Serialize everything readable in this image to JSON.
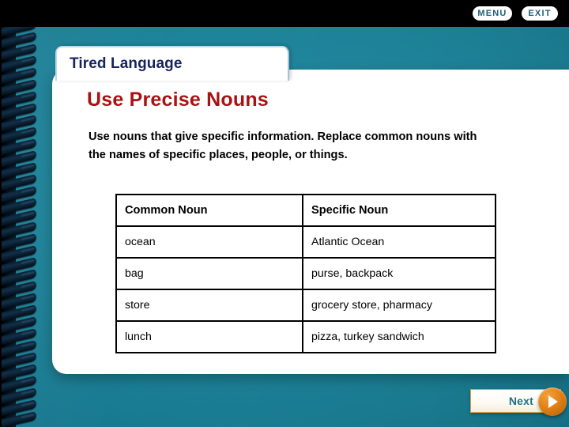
{
  "topbar": {
    "menu_label": "MENU",
    "exit_label": "EXIT"
  },
  "slide": {
    "tab_title": "Tired Language",
    "heading": "Use Precise Nouns",
    "body": "Use nouns that give specific information. Replace common nouns with the names of specific places, people, or things."
  },
  "table": {
    "headers": [
      "Common Noun",
      "Specific Noun"
    ],
    "rows": [
      [
        "ocean",
        "Atlantic Ocean"
      ],
      [
        "bag",
        "purse, backpack"
      ],
      [
        "store",
        "grocery store, pharmacy"
      ],
      [
        "lunch",
        "pizza, turkey sandwich"
      ]
    ]
  },
  "footer": {
    "next_label": "Next"
  },
  "colors": {
    "background_teal": "#1d8399",
    "topbar_black": "#000000",
    "heading_red": "#aa1113",
    "title_navy": "#16245c",
    "header_orange": "#c8862a",
    "header_blue": "#141a9a",
    "next_teal": "#1e7188",
    "next_orange": "#e07f13"
  }
}
